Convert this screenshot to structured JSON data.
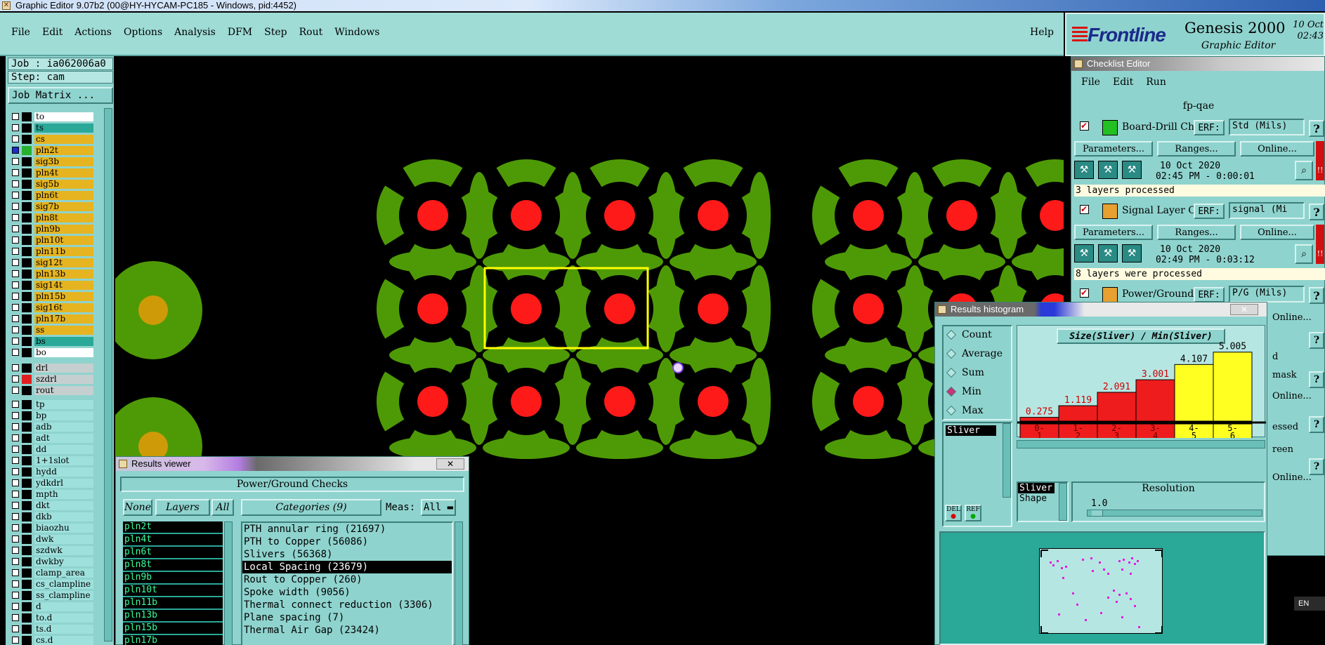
{
  "window": {
    "title": "Graphic Editor 9.07b2 (00@HY-HYCAM-PC185 - Windows, pid:4452)"
  },
  "menu": [
    "File",
    "Edit",
    "Actions",
    "Options",
    "Analysis",
    "DFM",
    "Step",
    "Rout",
    "Windows"
  ],
  "help": "Help",
  "brand": {
    "logo": "Frontline",
    "product": "Genesis 2000",
    "subtitle": "Graphic Editor",
    "date": "10 Oct",
    "time": "02:43"
  },
  "job": {
    "job": "Job : ia062006a0",
    "step": "Step: cam",
    "matrix": "Job Matrix ..."
  },
  "layers_a": [
    "to",
    "ts",
    "cs",
    "pln2t",
    "sig3b",
    "pln4t",
    "sig5b",
    "pln6t",
    "sig7b",
    "pln8t",
    "pln9b",
    "pln10t",
    "pln11b",
    "sig12t",
    "pln13b",
    "sig14t",
    "pln15b",
    "sig16t",
    "pln17b",
    "ss",
    "bs",
    "bo"
  ],
  "layers_b": [
    "drl",
    "szdrl",
    "rout"
  ],
  "layers_c": [
    "tp",
    "bp",
    "adb",
    "adt",
    "dd",
    "1+1slot",
    "hydd",
    "ydkdrl",
    "mpth",
    "dkt",
    "dkb",
    "biaozhu",
    "dwk",
    "szdwk",
    "dwkby",
    "clamp_area",
    "cs_clampline",
    "ss_clampline",
    "d",
    "to.d",
    "ts.d",
    "cs.d"
  ],
  "checklist": {
    "title": "Checklist Editor",
    "menu": [
      "File",
      "Edit",
      "Run"
    ],
    "name": "fp-qae",
    "erf_label": "ERF:",
    "params": "Parameters...",
    "ranges": "Ranges...",
    "online": "Online...",
    "help": "?",
    "checks": [
      {
        "name": "Board-Drill Checks",
        "erf": "Std (Mils)",
        "date": "10 Oct 2020",
        "time": "02:45 PM - 0:00:01",
        "status": "3 layers processed"
      },
      {
        "name": "Signal Layer Checks",
        "erf": "signal (Mi",
        "date": "10 Oct 2020",
        "time": "02:49 PM - 0:03:12",
        "status": "8 layers were processed"
      },
      {
        "name": "Power/Ground Checks",
        "erf": "P/G (Mils)",
        "date": "",
        "time": "",
        "status": ""
      }
    ],
    "partial": [
      "Online...",
      "d",
      "mask",
      "Online...",
      "essed",
      "reen",
      "Online..."
    ]
  },
  "viewer": {
    "title": "Results viewer",
    "header": "Power/Ground Checks",
    "none": "None",
    "layers": "Layers",
    "all": "All",
    "categories": "Categories (9)",
    "meas": "Meas:",
    "meas_value": "All",
    "layer_list": [
      "pln2t",
      "pln4t",
      "pln6t",
      "pln8t",
      "pln9b",
      "pln10t",
      "pln11b",
      "pln13b",
      "pln15b",
      "pln17b"
    ],
    "cats": [
      "PTH annular ring (21697)",
      "PTH to Copper (56086)",
      "Slivers (56368)",
      "Local Spacing (23679)",
      "Rout to Copper (260)",
      "Spoke width (9056)",
      "Thermal connect reduction (3306)",
      "Plane spacing (7)",
      "Thermal Air Gap (23424)"
    ]
  },
  "histogram": {
    "title": "Results histogram",
    "modes": [
      "Count",
      "Average",
      "Sum",
      "Min",
      "Max"
    ],
    "selected": "Min",
    "list_item": "Sliver",
    "del": "DEL",
    "ref": "REF",
    "legend": [
      "Sliver",
      "Shape"
    ],
    "resolution_label": "Resolution",
    "resolution_value": "1.0"
  },
  "chart_data": {
    "type": "bar",
    "title": "Size(Sliver) / Min(Sliver)",
    "categories": [
      "0-1",
      "1-2",
      "2-3",
      "3-4",
      "4-5",
      "5-6"
    ],
    "values": [
      0.275,
      1.119,
      2.091,
      3.001,
      4.107,
      5.005
    ],
    "colors": [
      "#ee1c1c",
      "#ee1c1c",
      "#ee1c1c",
      "#ee1c1c",
      "#ffff22",
      "#ffff22"
    ]
  },
  "colors": {
    "copper": "#4e9a06",
    "pad": "#ff1a1a",
    "select": "#ffff00",
    "panel": "#8fd3ce"
  }
}
